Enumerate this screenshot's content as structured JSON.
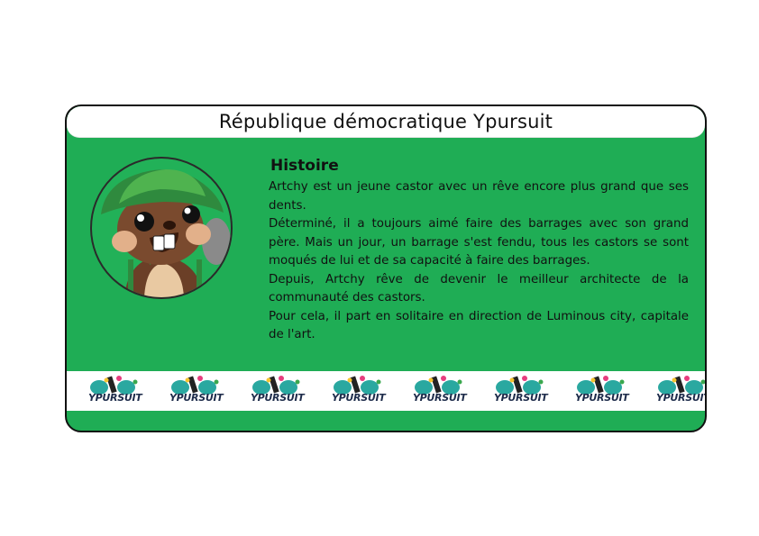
{
  "card": {
    "title": "République démocratique Ypursuit",
    "heading": "Histoire",
    "paragraphs": [
      "Artchy est un jeune castor avec un rêve encore plus grand que ses dents.",
      "Déterminé, il a toujours aimé faire des barrages avec son grand père. Mais un jour, un barrage s'est fendu, tous les castors se sont moqués de lui et de sa capacité à faire des barrages.",
      "Depuis, Artchy rêve de devenir le meilleur architecte de la communauté des castors.",
      "Pour cela, il part en solitaire en direction de Luminous city, capitale de l'art."
    ],
    "avatar_icon": "beaver-character-icon",
    "logo_text": "YPURSUIT",
    "logo_icon": "ypursuit-logo-icon",
    "colors": {
      "card_green": "#1fad55",
      "hat_green": "#2f8a3e",
      "fur_brown": "#7a4a2e"
    }
  }
}
